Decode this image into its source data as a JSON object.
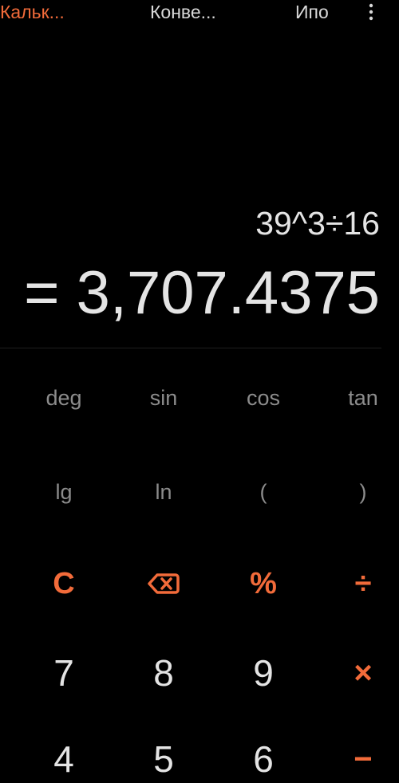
{
  "tabs": [
    {
      "label": "Кальк..."
    },
    {
      "label": "Конве..."
    },
    {
      "label": "Ипо"
    }
  ],
  "display": {
    "expression": "39^3÷16",
    "result": "= 3,707.4375"
  },
  "keys": {
    "deg": "deg",
    "sin": "sin",
    "cos": "cos",
    "tan": "tan",
    "lg": "lg",
    "ln": "ln",
    "lparen": "(",
    "rparen": ")",
    "clear": "C",
    "percent": "%",
    "divide": "÷",
    "seven": "7",
    "eight": "8",
    "nine": "9",
    "multiply": "×",
    "four": "4",
    "five": "5",
    "six": "6",
    "minus": "−"
  },
  "icons": {
    "more": "more-vertical-icon",
    "backspace": "backspace-icon"
  },
  "colors": {
    "accent": "#f26b3a",
    "background": "#000000",
    "text": "#e4e4e4",
    "muted": "#8c8c8c"
  }
}
